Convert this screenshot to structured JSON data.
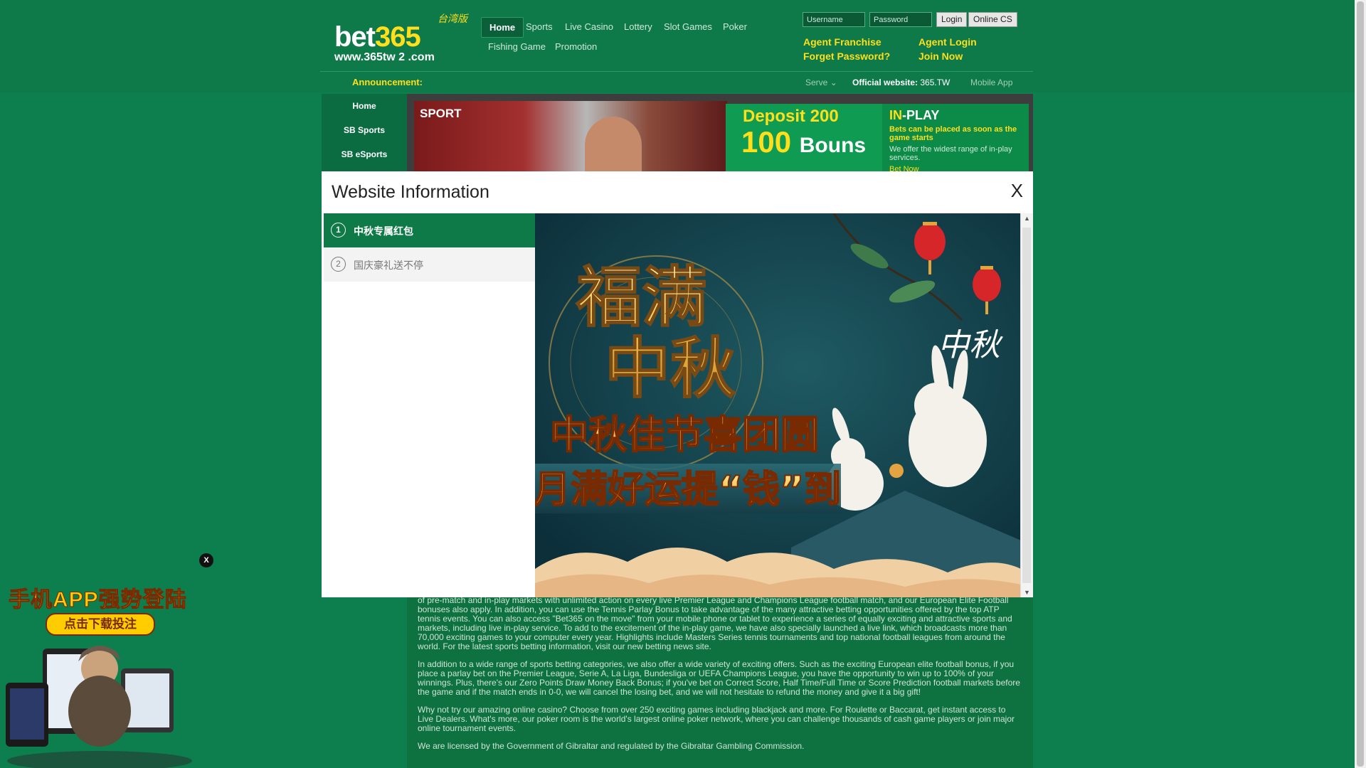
{
  "logo": {
    "brand_a": "bet",
    "brand_b": "365",
    "url": "www.365tw 2 .com",
    "tag": "台湾版"
  },
  "nav": [
    {
      "label": "Home"
    },
    {
      "label": "Sports"
    },
    {
      "label": "Live Casino"
    },
    {
      "label": "Lottery"
    },
    {
      "label": "Slot Games"
    },
    {
      "label": "Poker"
    },
    {
      "label": "Fishing Game"
    },
    {
      "label": "Promotion"
    }
  ],
  "login": {
    "username_placeholder": "Username",
    "password_placeholder": "Password",
    "login_label": "Login",
    "online_cs_label": "Online CS",
    "agent_franchise": "Agent Franchise",
    "agent_login": "Agent Login",
    "forget_password": "Forget Password?",
    "join_now": "Join Now"
  },
  "announcement": {
    "label": "Announcement:",
    "serve": "Serve",
    "official_label": "Official website:",
    "official_value": "365.TW",
    "mobile_app": "Mobile App"
  },
  "left_menu": [
    "Home",
    "SB Sports",
    "SB eSports"
  ],
  "banner": {
    "sport": "SPORT",
    "deposit_line": "Deposit 200",
    "bonus_num": "100",
    "bonus_word": "Bouns",
    "inplay_a": "IN",
    "inplay_b": "-PLAY",
    "inplay_line1": "Bets can be placed as soon as the game starts",
    "inplay_line2": "We offer the widest range of in-play services.",
    "bet_now": "Bet Now"
  },
  "modal": {
    "title": "Website Information",
    "close": "X",
    "tabs": [
      {
        "num": "1",
        "label": "中秋专属红包"
      },
      {
        "num": "2",
        "label": "国庆豪礼送不停"
      }
    ],
    "image_text_1": "福满中秋",
    "image_text_2": "中秋佳节喜团圆",
    "image_text_3": "月满好运提“钱”到",
    "image_seal": "中秋"
  },
  "content": {
    "p1": "of pre-match and in-play markets with unlimited action on every live Premier League and Champions League football match, and our European Elite Football bonuses also apply. In addition, you can use the Tennis Parlay Bonus to take advantage of the many attractive betting opportunities offered by the top ATP tennis events. You can also access \"Bet365 on the move\" from your mobile phone or tablet to experience a series of equally exciting and attractive sports and markets, including live in-play service. To add to the excitement of the in-play game, we have also specially launched a live link, which broadcasts more than 70,000 exciting games to your computer every year. Highlights include Masters Series tennis tournaments and top national football leagues from around the world. For the latest sports betting information, visit our new betting news site.",
    "p2": "In addition to a wide range of sports betting categories, we also offer a wide variety of exciting offers. Such as the exciting European elite football bonus, if you place a parlay bet on the Premier League, Serie A, La Liga, Bundesliga or UEFA Champions League, you have the opportunity to win up to 100% of your winnings. Plus, there's our Zero Points Draw Money Back Bonus; if you've bet on Correct Score, Half Time/Full Time or Score Prediction football markets before the game and if the match ends in 0-0, we will cancel the losing bet, and we will not hesitate to refund the money and give it a big gift!",
    "p3": "Why not try our amazing online casino? Choose from over 250 exciting games including blackjack and more. For Roulette or Baccarat, get instant access to Live Dealers. What's more, our poker room is the world's largest online poker network, where you can challenge thousands of cash game players or join major online tournament events.",
    "p4": "We are licensed by the Government of Gibraltar and regulated by the Gibraltar Gambling Commission."
  },
  "app_promo": {
    "close": "X",
    "title": "手机APP强势登陆",
    "button": "点击下载投注"
  }
}
